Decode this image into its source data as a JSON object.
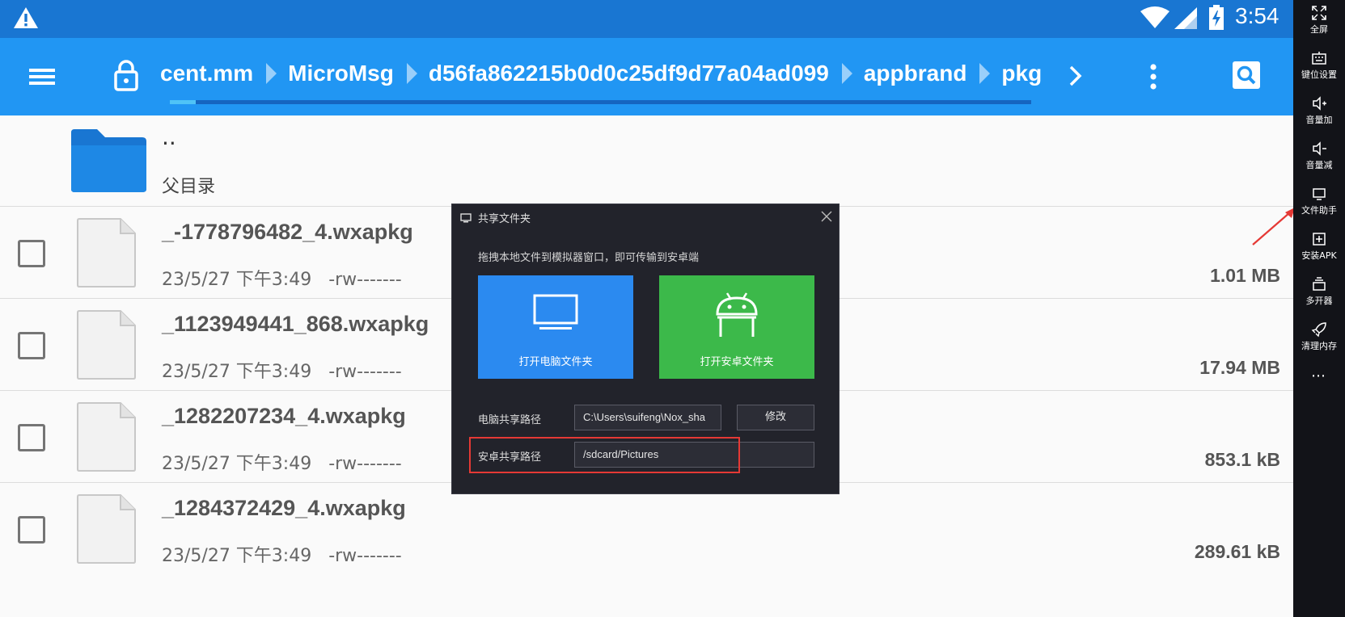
{
  "status_bar": {
    "time": "3:54",
    "icons": [
      "warning-icon",
      "wifi-icon",
      "signal-icon",
      "battery-charging-icon"
    ]
  },
  "toolbar": {
    "breadcrumbs": [
      "cent.mm",
      "MicroMsg",
      "d56fa862215b0d0c25df9d77a04ad099",
      "appbrand",
      "pkg"
    ],
    "progress": 0.03
  },
  "list": {
    "parent": {
      "name": "..",
      "label": "父目录"
    },
    "files": [
      {
        "name": "_-1778796482_4.wxapkg",
        "date": "23/5/27 下午3:49",
        "perm": "-rw-------",
        "size": "1.01 MB"
      },
      {
        "name": "_1123949441_868.wxapkg",
        "date": "23/5/27 下午3:49",
        "perm": "-rw-------",
        "size": "17.94 MB"
      },
      {
        "name": "_1282207234_4.wxapkg",
        "date": "23/5/27 下午3:49",
        "perm": "-rw-------",
        "size": "853.1 kB"
      },
      {
        "name": "_1284372429_4.wxapkg",
        "date": "23/5/27 下午3:49",
        "perm": "-rw-------",
        "size": "289.61 kB"
      }
    ]
  },
  "dialog": {
    "title": "共享文件夹",
    "hint": "拖拽本地文件到模拟器窗口，即可传输到安卓端",
    "open_pc_folder": "打开电脑文件夹",
    "open_android_folder": "打开安卓文件夹",
    "pc_path_label": "电脑共享路径",
    "pc_path_value": "C:\\Users\\suifeng\\Nox_sha",
    "modify_label": "修改",
    "android_path_label": "安卓共享路径",
    "android_path_value": "/sdcard/Pictures"
  },
  "sidebar": {
    "items": [
      {
        "label": "全屏",
        "icon": "fullscreen-icon"
      },
      {
        "label": "键位设置",
        "icon": "keyboard-icon"
      },
      {
        "label": "音量加",
        "icon": "volume-up-icon"
      },
      {
        "label": "音量减",
        "icon": "volume-down-icon"
      },
      {
        "label": "文件助手",
        "icon": "file-assistant-icon"
      },
      {
        "label": "安装APK",
        "icon": "install-apk-icon"
      },
      {
        "label": "多开器",
        "icon": "multi-instance-icon"
      },
      {
        "label": "清理内存",
        "icon": "rocket-icon"
      }
    ],
    "more": "⋯"
  },
  "colors": {
    "status_bar": "#1976d2",
    "toolbar": "#2196f3",
    "pc_tile": "#2b8af0",
    "android_tile": "#3cb94a",
    "highlight": "#e53935"
  }
}
